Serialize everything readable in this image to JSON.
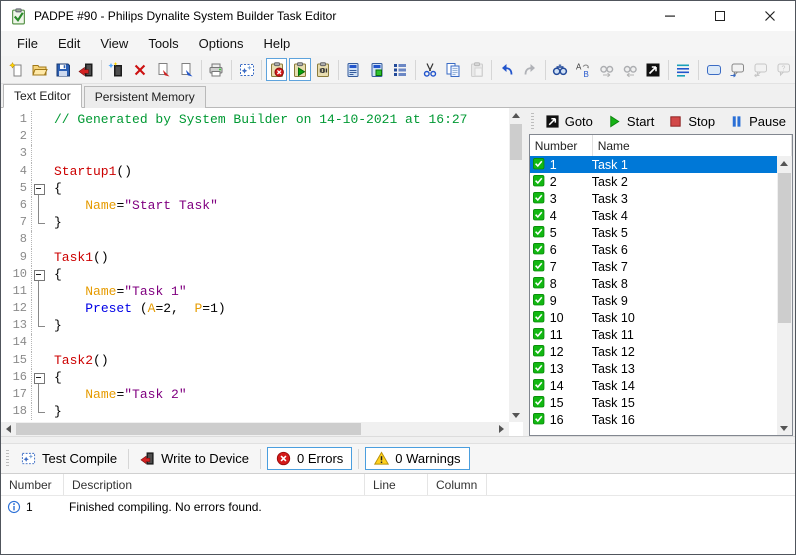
{
  "window": {
    "title": "PADPE #90 - Philips Dynalite System Builder Task Editor",
    "app_icon": "green-clipboard-check",
    "caption_buttons": [
      "minimize",
      "maximize",
      "close"
    ]
  },
  "menu": {
    "items": [
      "File",
      "Edit",
      "View",
      "Tools",
      "Options",
      "Help"
    ]
  },
  "toolbar": {
    "icons": [
      "new-file",
      "open-file",
      "save",
      "write-to-device",
      "|",
      "new-task",
      "delete-task",
      "copy-task",
      "paste-task",
      "|",
      "print",
      "|",
      "compile",
      "|",
      "stop-all-tasks",
      "start-all-tasks",
      "persistent-memory",
      "|",
      "device-tasks",
      "device-memory",
      "device-list",
      "|",
      "cut",
      "copy",
      "paste",
      "|",
      "undo",
      "redo",
      "|",
      "find",
      "replace",
      "find-next",
      "find-previous",
      "goto-line",
      "|",
      "format",
      "|",
      "comment-block",
      "comment-add",
      "comment-remove",
      "comment-help"
    ],
    "disabled": [
      "paste",
      "redo",
      "find-next",
      "find-previous",
      "comment-remove",
      "comment-help"
    ],
    "active": [
      "stop-all-tasks",
      "start-all-tasks"
    ]
  },
  "tabs": [
    {
      "label": "Text Editor",
      "active": true
    },
    {
      "label": "Persistent Memory",
      "active": false
    }
  ],
  "editor": {
    "lines": [
      {
        "n": 1,
        "fold": "",
        "segs": [
          [
            "comment",
            "// Generated by System Builder on 14-10-2021 at 16:27"
          ]
        ]
      },
      {
        "n": 2,
        "fold": "",
        "segs": []
      },
      {
        "n": 3,
        "fold": "",
        "segs": []
      },
      {
        "n": 4,
        "fold": "",
        "segs": [
          [
            "task",
            "Startup1"
          ],
          [
            "plain",
            "()"
          ]
        ]
      },
      {
        "n": 5,
        "fold": "box",
        "segs": [
          [
            "plain",
            "{"
          ]
        ]
      },
      {
        "n": 6,
        "fold": "line",
        "segs": [
          [
            "plain",
            "    "
          ],
          [
            "name",
            "Name"
          ],
          [
            "plain",
            "="
          ],
          [
            "str",
            "\"Start Task\""
          ]
        ]
      },
      {
        "n": 7,
        "fold": "end",
        "segs": [
          [
            "plain",
            "}"
          ]
        ]
      },
      {
        "n": 8,
        "fold": "",
        "segs": []
      },
      {
        "n": 9,
        "fold": "",
        "segs": [
          [
            "task",
            "Task1"
          ],
          [
            "plain",
            "()"
          ]
        ]
      },
      {
        "n": 10,
        "fold": "box",
        "segs": [
          [
            "plain",
            "{"
          ]
        ]
      },
      {
        "n": 11,
        "fold": "line",
        "segs": [
          [
            "plain",
            "    "
          ],
          [
            "name",
            "Name"
          ],
          [
            "plain",
            "="
          ],
          [
            "str",
            "\"Task 1\""
          ]
        ]
      },
      {
        "n": 12,
        "fold": "line",
        "segs": [
          [
            "plain",
            "    "
          ],
          [
            "kw",
            "Preset"
          ],
          [
            "plain",
            " ("
          ],
          [
            "name",
            "A"
          ],
          [
            "plain",
            "=2,  "
          ],
          [
            "name",
            "P"
          ],
          [
            "plain",
            "=1)"
          ]
        ]
      },
      {
        "n": 13,
        "fold": "end",
        "segs": [
          [
            "plain",
            "}"
          ]
        ]
      },
      {
        "n": 14,
        "fold": "",
        "segs": []
      },
      {
        "n": 15,
        "fold": "",
        "segs": [
          [
            "task",
            "Task2"
          ],
          [
            "plain",
            "()"
          ]
        ]
      },
      {
        "n": 16,
        "fold": "box",
        "segs": [
          [
            "plain",
            "{"
          ]
        ]
      },
      {
        "n": 17,
        "fold": "line",
        "segs": [
          [
            "plain",
            "    "
          ],
          [
            "name",
            "Name"
          ],
          [
            "plain",
            "="
          ],
          [
            "str",
            "\"Task 2\""
          ]
        ]
      },
      {
        "n": 18,
        "fold": "end",
        "segs": [
          [
            "plain",
            "}"
          ]
        ]
      }
    ]
  },
  "right_panel": {
    "buttons": [
      {
        "label": "Goto",
        "icon": "goto-line"
      },
      {
        "label": "Start",
        "icon": "start"
      },
      {
        "label": "Stop",
        "icon": "stop"
      },
      {
        "label": "Pause",
        "icon": "pause"
      }
    ],
    "columns": [
      "Number",
      "Name"
    ],
    "selected_index": 0,
    "tasks": [
      {
        "number": 1,
        "name": "Task 1"
      },
      {
        "number": 2,
        "name": "Task 2"
      },
      {
        "number": 3,
        "name": "Task 3"
      },
      {
        "number": 4,
        "name": "Task 4"
      },
      {
        "number": 5,
        "name": "Task 5"
      },
      {
        "number": 6,
        "name": "Task 6"
      },
      {
        "number": 7,
        "name": "Task 7"
      },
      {
        "number": 8,
        "name": "Task 8"
      },
      {
        "number": 9,
        "name": "Task 9"
      },
      {
        "number": 10,
        "name": "Task 10"
      },
      {
        "number": 11,
        "name": "Task 11"
      },
      {
        "number": 12,
        "name": "Task 12"
      },
      {
        "number": 13,
        "name": "Task 13"
      },
      {
        "number": 14,
        "name": "Task 14"
      },
      {
        "number": 15,
        "name": "Task 15"
      },
      {
        "number": 16,
        "name": "Task 16"
      }
    ]
  },
  "bottom_toolbar": {
    "test_compile": "Test Compile",
    "write_to_device": "Write to Device",
    "errors": "0 Errors",
    "warnings": "0 Warnings"
  },
  "messages": {
    "columns": [
      "Number",
      "Description",
      "Line",
      "Column"
    ],
    "rows": [
      {
        "icon": "info",
        "number": "1",
        "description": "Finished compiling. No errors found.",
        "line": "",
        "column": ""
      }
    ]
  },
  "colors": {
    "selection": "#0078d7",
    "check_green": "#12b812",
    "syntax_comment": "#009933",
    "syntax_task": "#cc0000",
    "syntax_identifier": "#e69b00",
    "syntax_string": "#800080",
    "syntax_keyword": "#0000e6"
  }
}
